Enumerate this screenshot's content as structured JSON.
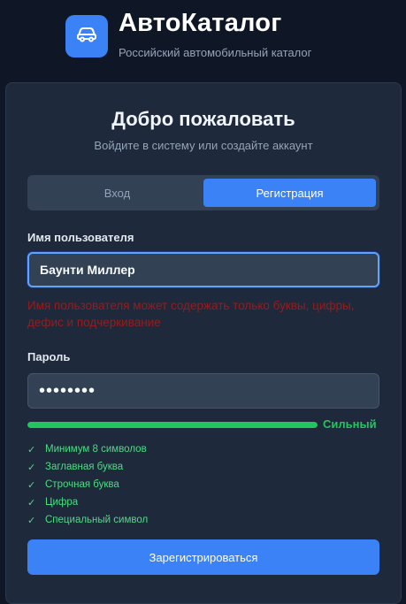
{
  "app": {
    "logo_icon": "car-icon",
    "title": "АвтоКаталог",
    "subtitle": "Российский автомобильный каталог"
  },
  "card": {
    "title": "Добро пожаловать",
    "subtitle": "Войдите в систему или создайте аккаунт"
  },
  "tabs": {
    "login_label": "Вход",
    "register_label": "Регистрация",
    "active": "register"
  },
  "form": {
    "username_label": "Имя пользователя",
    "username_value": "Баунти Миллер",
    "username_error": "Имя пользователя может содержать только буквы, цифры, дефис и подчеркивание",
    "password_label": "Пароль",
    "password_value": "••••••••",
    "password_strength": {
      "label": "Сильный",
      "fraction": 1.0
    },
    "requirements": [
      {
        "label": "Минимум 8 символов",
        "met": true
      },
      {
        "label": "Заглавная буква",
        "met": true
      },
      {
        "label": "Строчная буква",
        "met": true
      },
      {
        "label": "Цифра",
        "met": true
      },
      {
        "label": "Специальный символ",
        "met": true
      }
    ],
    "submit_label": "Зарегистрироваться"
  },
  "colors": {
    "background": "#0f1726",
    "card": "#1e293b",
    "accent": "#3b82f6",
    "success": "#22c55e",
    "error": "#991b1b"
  }
}
